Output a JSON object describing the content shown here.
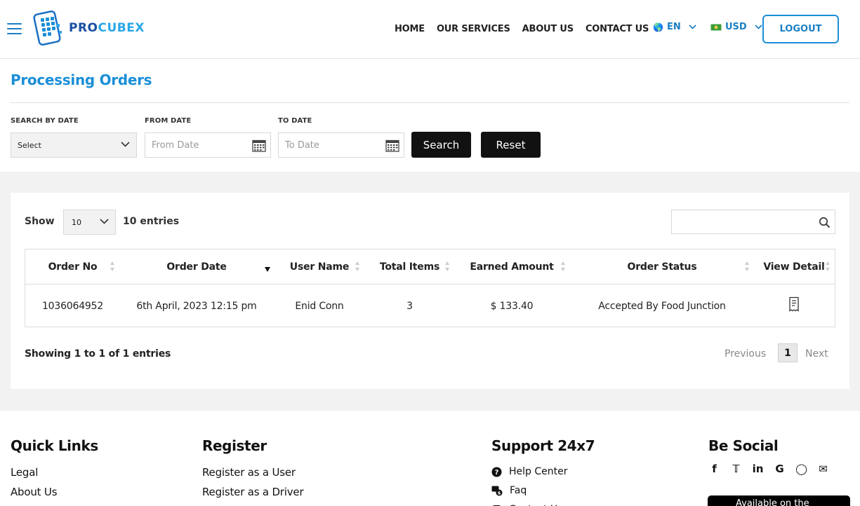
{
  "header": {
    "brand": {
      "part1": "PRO",
      "part2": "CUBEX"
    },
    "nav": [
      "HOME",
      "OUR SERVICES",
      "ABOUT US",
      "CONTACT US"
    ],
    "language": "EN",
    "currency": "USD",
    "logout_label": "LOGOUT"
  },
  "page": {
    "title": "Processing Orders"
  },
  "filters": {
    "search_by_date_label": "SEARCH BY DATE",
    "search_by_date_value": "Select",
    "from_date_label": "FROM DATE",
    "from_date_placeholder": "From Date",
    "to_date_label": "TO DATE",
    "to_date_placeholder": "To Date",
    "search_label": "Search",
    "reset_label": "Reset"
  },
  "table": {
    "show_label": "Show",
    "entries_value": "10",
    "entries_label": "10 entries",
    "columns": [
      "Order No",
      "Order Date",
      "User Name",
      "Total Items",
      "Earned Amount",
      "Order Status",
      "View Detail"
    ],
    "rows": [
      {
        "order_no": "1036064952",
        "order_date": "6th April, 2023 12:15 pm",
        "user_name": "Enid Conn",
        "total_items": "3",
        "earned_amount": "$ 133.40",
        "order_status": "Accepted By Food Junction"
      }
    ],
    "showing_text": "Showing 1 to 1 of 1 entries",
    "pagination": {
      "previous": "Previous",
      "current": "1",
      "next": "Next"
    }
  },
  "footer": {
    "quick_links": {
      "title": "Quick Links",
      "items": [
        "Legal",
        "About Us"
      ]
    },
    "register": {
      "title": "Register",
      "items": [
        "Register as a User",
        "Register as a Driver"
      ]
    },
    "support": {
      "title": "Support 24x7",
      "items": [
        "Help Center",
        "Faq",
        "Contact Us"
      ]
    },
    "social": {
      "title": "Be Social",
      "icons": [
        "facebook-icon",
        "twitter-icon",
        "linkedin-icon",
        "google-icon",
        "instagram-icon",
        "email-icon"
      ]
    },
    "store_button": "Available on the"
  },
  "colors": {
    "brand_blue": "#1a8ed8",
    "dark_button": "#111111"
  }
}
